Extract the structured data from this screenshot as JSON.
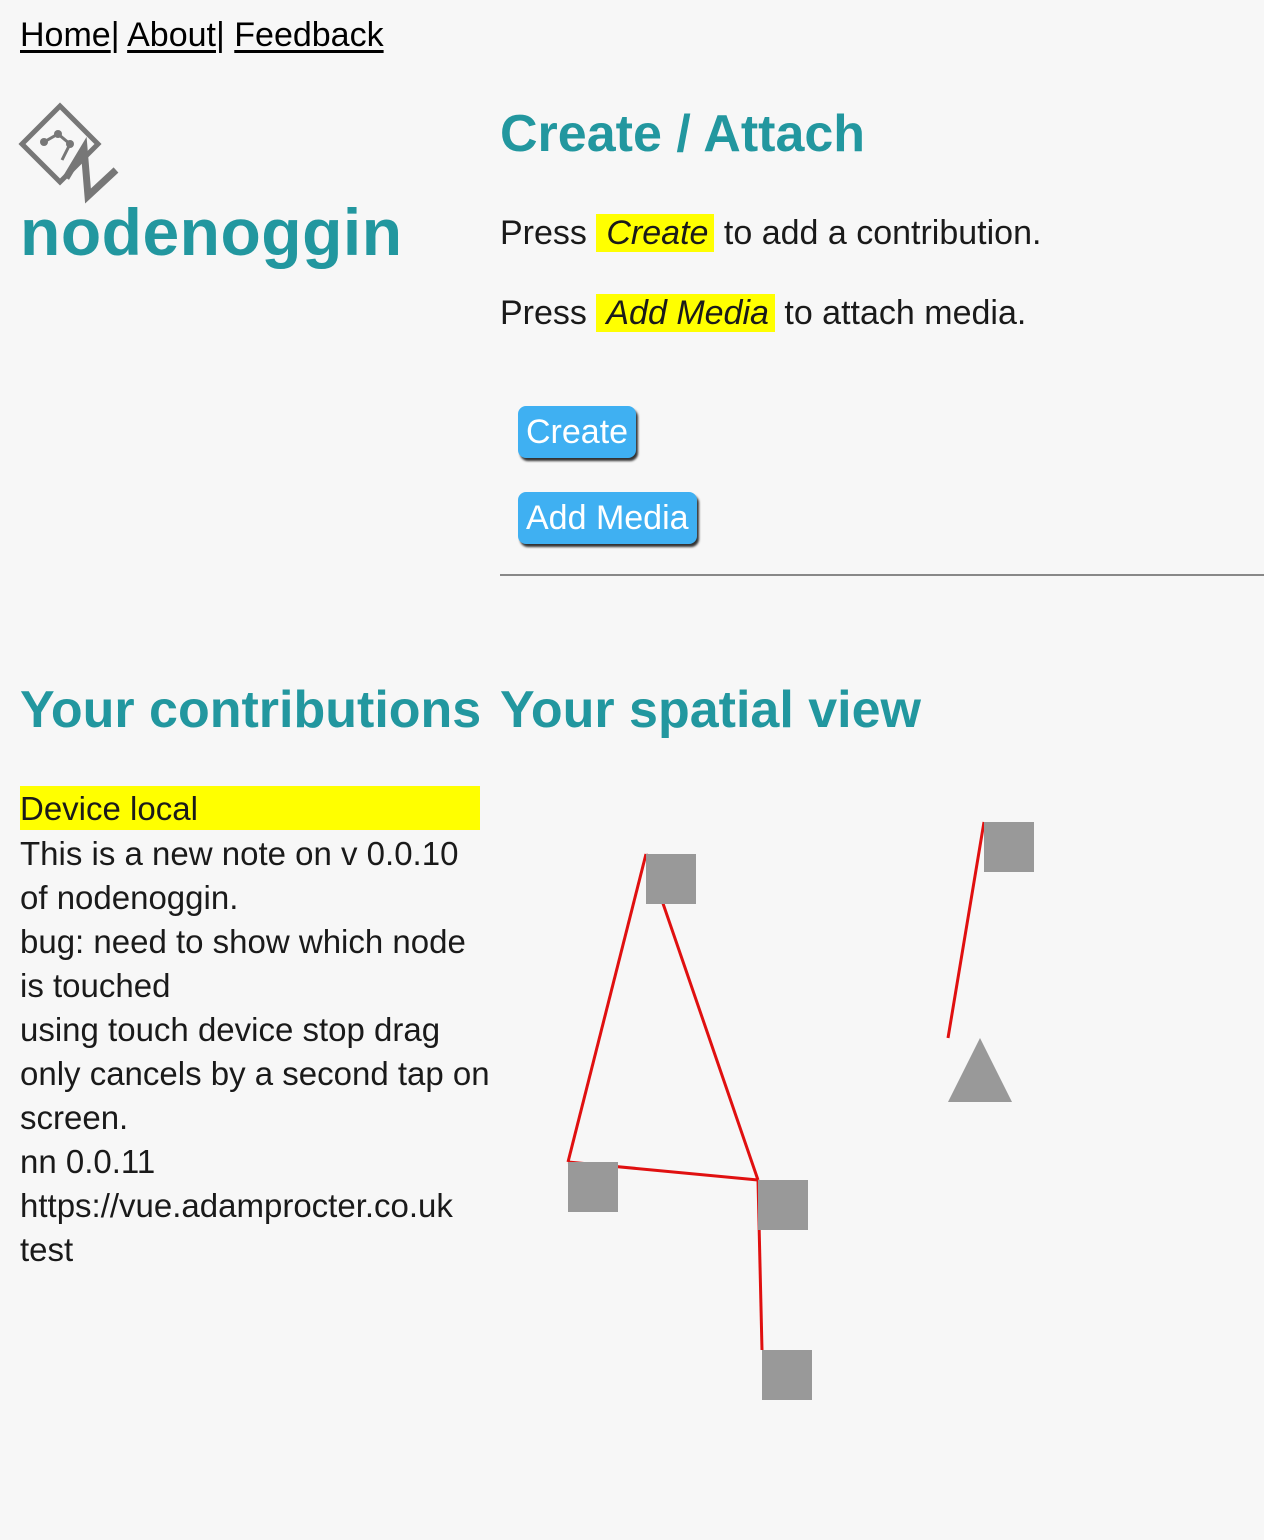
{
  "nav": {
    "items": [
      {
        "label": "Home"
      },
      {
        "label": "About"
      },
      {
        "label": "Feedback"
      }
    ],
    "separator": "|"
  },
  "brand": {
    "name": "nodenoggin",
    "logo_icon": "nodenoggin-logo-icon"
  },
  "create_section": {
    "title": "Create / Attach",
    "instruction1": {
      "prefix": "Press",
      "highlight": "Create",
      "suffix": "to add a contribution."
    },
    "instruction2": {
      "prefix": "Press",
      "highlight": "Add Media",
      "suffix": "to attach media."
    },
    "create_button": "Create",
    "add_media_button": "Add Media"
  },
  "contributions": {
    "title": "Your contributions",
    "group_label": "Device local",
    "items": [
      "This is a new note on v 0.0.10 of nodenoggin.",
      "bug: need to show which node is touched",
      "using touch device stop drag only cancels by a second tap on screen.",
      "nn 0.0.11",
      "https://vue.adamprocter.co.uk",
      "test"
    ]
  },
  "spatial": {
    "title": "Your spatial view",
    "colors": {
      "node": "#999999",
      "link": "#e01010",
      "accent": "#22979f",
      "highlight": "#ffff00",
      "button": "#3fb0f2"
    }
  }
}
